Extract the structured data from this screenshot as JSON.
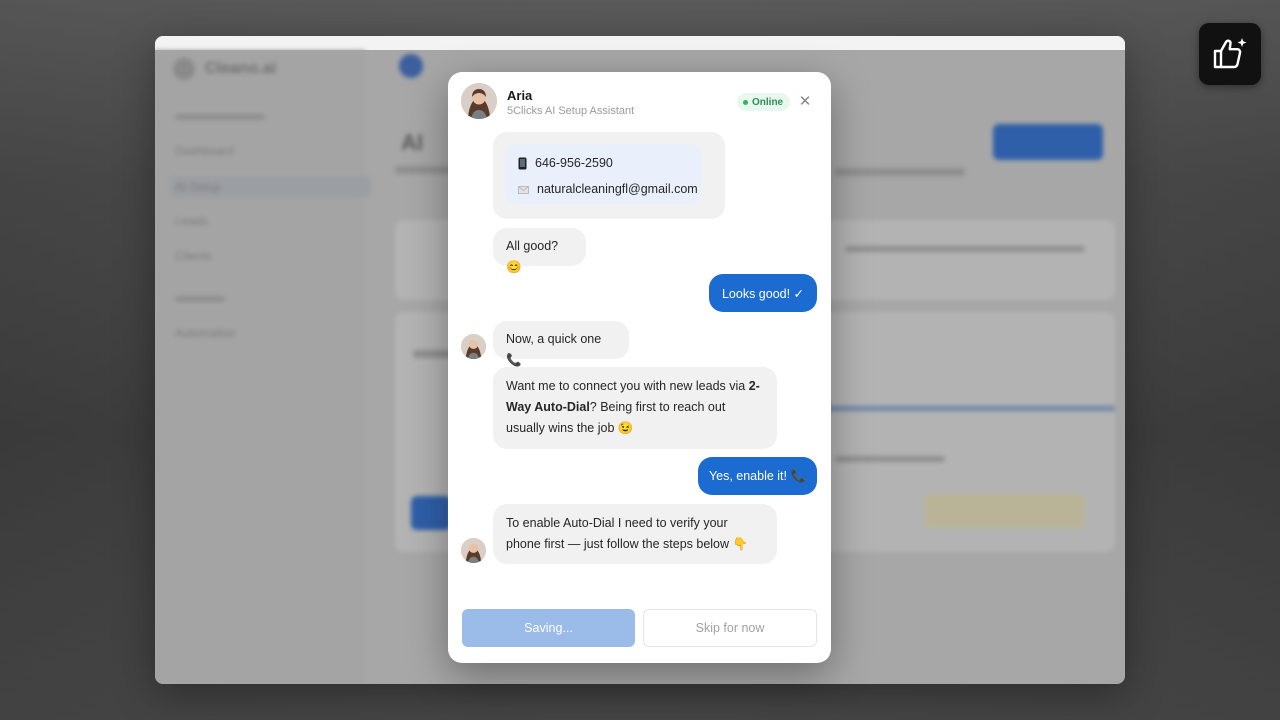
{
  "background_app": {
    "logo_text": "Cleano.ai",
    "nav": [
      "Dashboard",
      "AI Setup",
      "Leads",
      "Clients",
      "Automation"
    ],
    "page_title": "AI"
  },
  "assistant": {
    "name": "Aria",
    "subtitle": "5Clicks AI Setup Assistant",
    "status": "Online"
  },
  "contact": {
    "phone": "646-956-2590",
    "email": "naturalcleaningfl@gmail.com",
    "phone_icon": "phone-icon",
    "email_icon": "mail-icon"
  },
  "messages": {
    "all_good": "All good? 😊",
    "looks_good": "Looks good! ✓",
    "quick_one": "Now, a quick one 📞",
    "autodial_pre": "Want me to connect you with new leads via ",
    "autodial_bold": "2-Way Auto-Dial",
    "autodial_post": "? Being first to reach out usually wins the job 😉",
    "enable_reply": "Yes, enable it! 📞",
    "verify": "To enable Auto-Dial I need to verify your phone first — just follow the steps below 👇"
  },
  "buttons": {
    "saving": "Saving...",
    "skip": "Skip for now"
  },
  "colors": {
    "accent": "#1b6bd1",
    "saving_button": "#9bbbe8",
    "online": "#2fb45c"
  }
}
